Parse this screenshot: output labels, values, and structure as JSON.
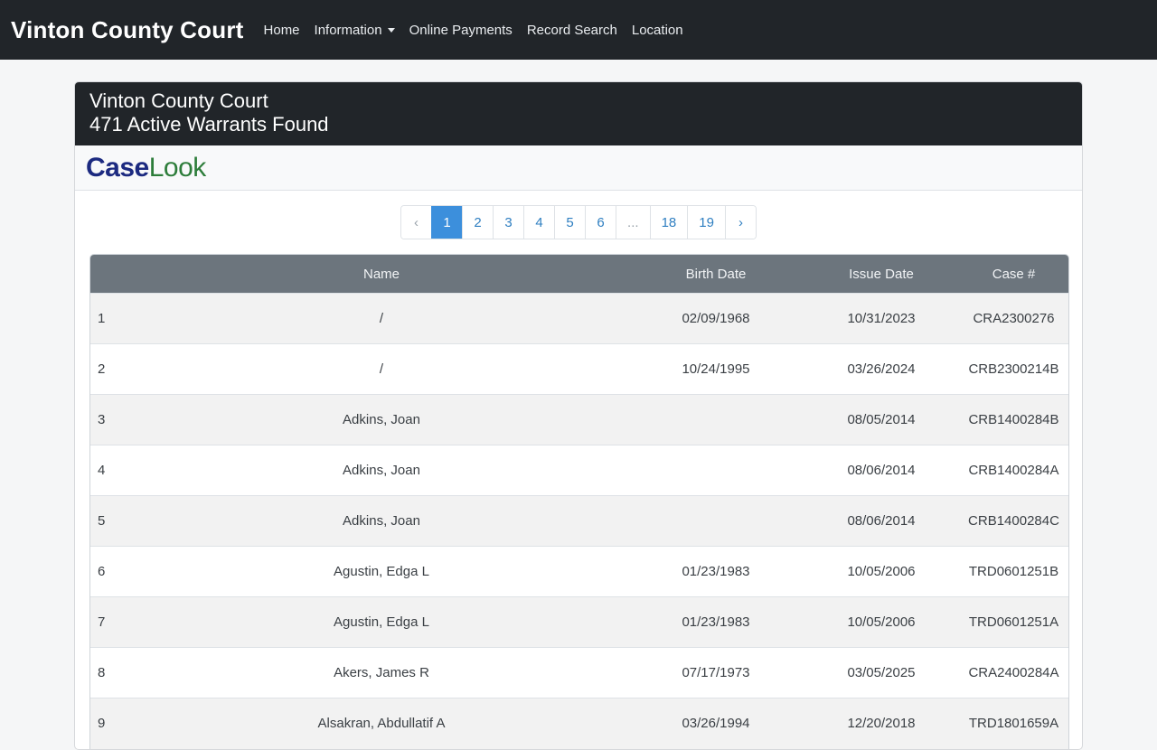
{
  "navbar": {
    "brand": "Vinton County Court",
    "links": [
      "Home",
      "Information",
      "Online Payments",
      "Record Search",
      "Location"
    ]
  },
  "card": {
    "title": "Vinton County Court",
    "subtitle": "471 Active Warrants Found",
    "logo_part1": "Case",
    "logo_part2": "Look"
  },
  "pagination": {
    "prev": "‹",
    "pages": [
      "1",
      "2",
      "3",
      "4",
      "5",
      "6",
      "...",
      "18",
      "19"
    ],
    "next": "›",
    "active_page": "1"
  },
  "table": {
    "headers": [
      "",
      "Name",
      "Birth Date",
      "Issue Date",
      "Case #"
    ],
    "rows": [
      [
        "1",
        "/",
        "02/09/1968",
        "10/31/2023",
        "CRA2300276"
      ],
      [
        "2",
        "/",
        "10/24/1995",
        "03/26/2024",
        "CRB2300214B"
      ],
      [
        "3",
        "Adkins, Joan",
        "",
        "08/05/2014",
        "CRB1400284B"
      ],
      [
        "4",
        "Adkins, Joan",
        "",
        "08/06/2014",
        "CRB1400284A"
      ],
      [
        "5",
        "Adkins, Joan",
        "",
        "08/06/2014",
        "CRB1400284C"
      ],
      [
        "6",
        "Agustin, Edga L",
        "01/23/1983",
        "10/05/2006",
        "TRD0601251B"
      ],
      [
        "7",
        "Agustin, Edga L",
        "01/23/1983",
        "10/05/2006",
        "TRD0601251A"
      ],
      [
        "8",
        "Akers, James R",
        "07/17/1973",
        "03/05/2025",
        "CRA2400284A"
      ],
      [
        "9",
        "Alsakran, Abdullatif A",
        "03/26/1994",
        "12/20/2018",
        "TRD1801659A"
      ]
    ]
  }
}
